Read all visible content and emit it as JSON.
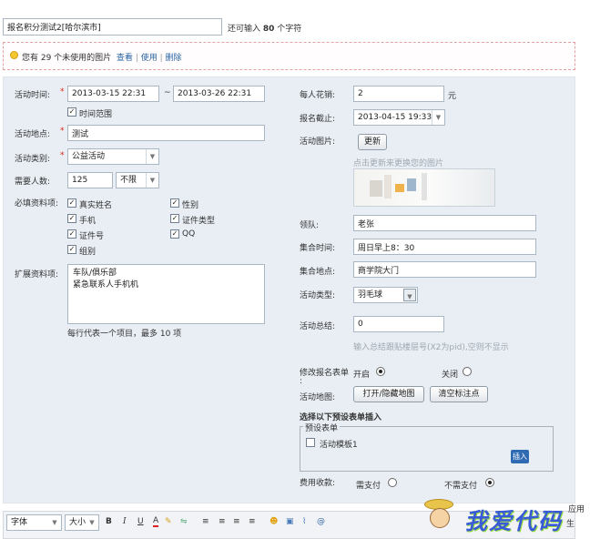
{
  "title_input": "报名积分测试2[哈尔滨市]",
  "char_hint": {
    "prefix": "还可输入",
    "count": "80",
    "suffix": "个字符"
  },
  "images_bar": {
    "text": "您有 29 个未使用的图片",
    "view": "查看",
    "use": "使用",
    "delete": "删除",
    "sep": "|"
  },
  "left": {
    "time_label": "活动时间:",
    "time_start": "2013-03-15 22:31",
    "tilde": "~",
    "time_end": "2013-03-26 22:31",
    "time_range_label": "时间范围",
    "place_label": "活动地点:",
    "place_value": "测试",
    "category_label": "活动类别:",
    "category_value": "公益活动",
    "need_label": "需要人数:",
    "need_value": "125",
    "need_limit": "不限",
    "required_label": "必填资料项:",
    "required_items": [
      "真实姓名",
      "性别",
      "手机",
      "证件类型",
      "证件号",
      "QQ",
      "组别"
    ],
    "ext_label": "扩展资料项:",
    "ext_lines": [
      "车队/俱乐部",
      "紧急联系人手机机"
    ],
    "ext_hint": "每行代表一个项目，最多 10 项"
  },
  "right": {
    "cost_label": "每人花销:",
    "cost_value": "2",
    "cost_unit": "元",
    "deadline_label": "报名截止:",
    "deadline_value": "2013-04-15 19:33",
    "image_label": "活动图片:",
    "update_btn": "更新",
    "image_hint": "点击更新来更换您的图片",
    "leader_label": "领队:",
    "leader_value": "老张",
    "gather_time_label": "集合时间:",
    "gather_time_value": "周日早上8：30",
    "gather_place_label": "集合地点:",
    "gather_place_value": "商学院大门",
    "type_label": "活动类型:",
    "type_value": "羽毛球",
    "summary_label": "活动总结:",
    "summary_value": "0",
    "summary_hint": "输入总结跟贴楼层号(X2为pid),空则不显示",
    "modify_label": "修改报名表单",
    "colon": ":",
    "open_label": "开启",
    "close_label": "关闭",
    "map_label": "活动地图:",
    "map_toggle_btn": "打开/隐藏地图",
    "map_clear_btn": "清空标注点",
    "preset_title": "选择以下预设表单插入",
    "preset_group": "预设表单",
    "preset_item": "活动模板1",
    "insert_btn": "插入",
    "fee_label": "费用收款:",
    "fee_need": "需支付",
    "fee_none": "不需支付"
  },
  "editor": {
    "font_label": "字体",
    "size_label": "大小",
    "bold": "B",
    "italic": "I",
    "underline": "U",
    "color": "A"
  },
  "watermark": {
    "text": "我爱代码",
    "side": "应用",
    "side2": "生"
  }
}
